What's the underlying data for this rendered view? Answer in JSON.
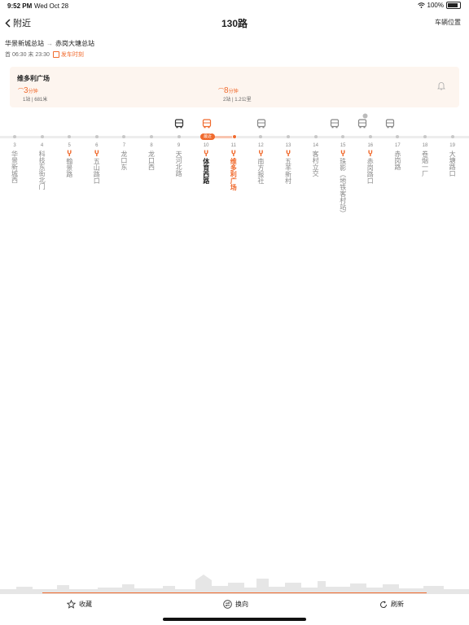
{
  "status_bar": {
    "time": "9:52 PM",
    "date": "Wed Oct 28",
    "battery": "100%"
  },
  "nav": {
    "back_label": "附近",
    "title": "130路",
    "right_label": "车辆位置"
  },
  "route": {
    "from": "华景新城总站",
    "to": "赤岗大塘总站",
    "hours": "首 06:30 末 23:30",
    "schedule_label": "发车时刻"
  },
  "card": {
    "stop_name": "维多利广场",
    "eta1": {
      "value": "3",
      "unit": "分钟",
      "detail": "1站 | 681米"
    },
    "eta2": {
      "value": "8",
      "unit": "分钟",
      "detail": "2站 | 1.2公里"
    }
  },
  "current_pill": "最近",
  "stops": [
    {
      "num": "3",
      "name": "华景新城西",
      "metro": false,
      "style": "normal"
    },
    {
      "num": "4",
      "name": "科技东街北门",
      "metro": false,
      "style": "normal"
    },
    {
      "num": "5",
      "name": "翰景路",
      "metro": true,
      "style": "normal"
    },
    {
      "num": "6",
      "name": "五山路口",
      "metro": true,
      "style": "normal"
    },
    {
      "num": "7",
      "name": "龙口东",
      "metro": false,
      "style": "normal"
    },
    {
      "num": "8",
      "name": "龙口西",
      "metro": false,
      "style": "normal"
    },
    {
      "num": "9",
      "name": "天河北路",
      "metro": false,
      "style": "normal"
    },
    {
      "num": "10",
      "name": "体育西路",
      "metro": true,
      "style": "bold"
    },
    {
      "num": "11",
      "name": "维多利广场",
      "metro": true,
      "style": "highlight"
    },
    {
      "num": "12",
      "name": "南方报社",
      "metro": true,
      "style": "normal"
    },
    {
      "num": "13",
      "name": "五羊新村",
      "metro": true,
      "style": "normal"
    },
    {
      "num": "14",
      "name": "客村立交",
      "metro": false,
      "style": "normal"
    },
    {
      "num": "15",
      "name": "珠影（地铁客村站）",
      "metro": true,
      "style": "normal"
    },
    {
      "num": "16",
      "name": "赤岗路口",
      "metro": true,
      "style": "normal"
    },
    {
      "num": "17",
      "name": "赤岗路",
      "metro": false,
      "style": "normal"
    },
    {
      "num": "18",
      "name": "卷烟一厂",
      "metro": false,
      "style": "normal"
    },
    {
      "num": "19",
      "name": "大塘路口",
      "metro": false,
      "style": "normal"
    }
  ],
  "bottom": {
    "collect_label": "收藏",
    "switch_label": "换向",
    "refresh_label": "刷新"
  },
  "colors": {
    "accent": "#f06a2d",
    "card_bg": "#fdf5ef"
  }
}
